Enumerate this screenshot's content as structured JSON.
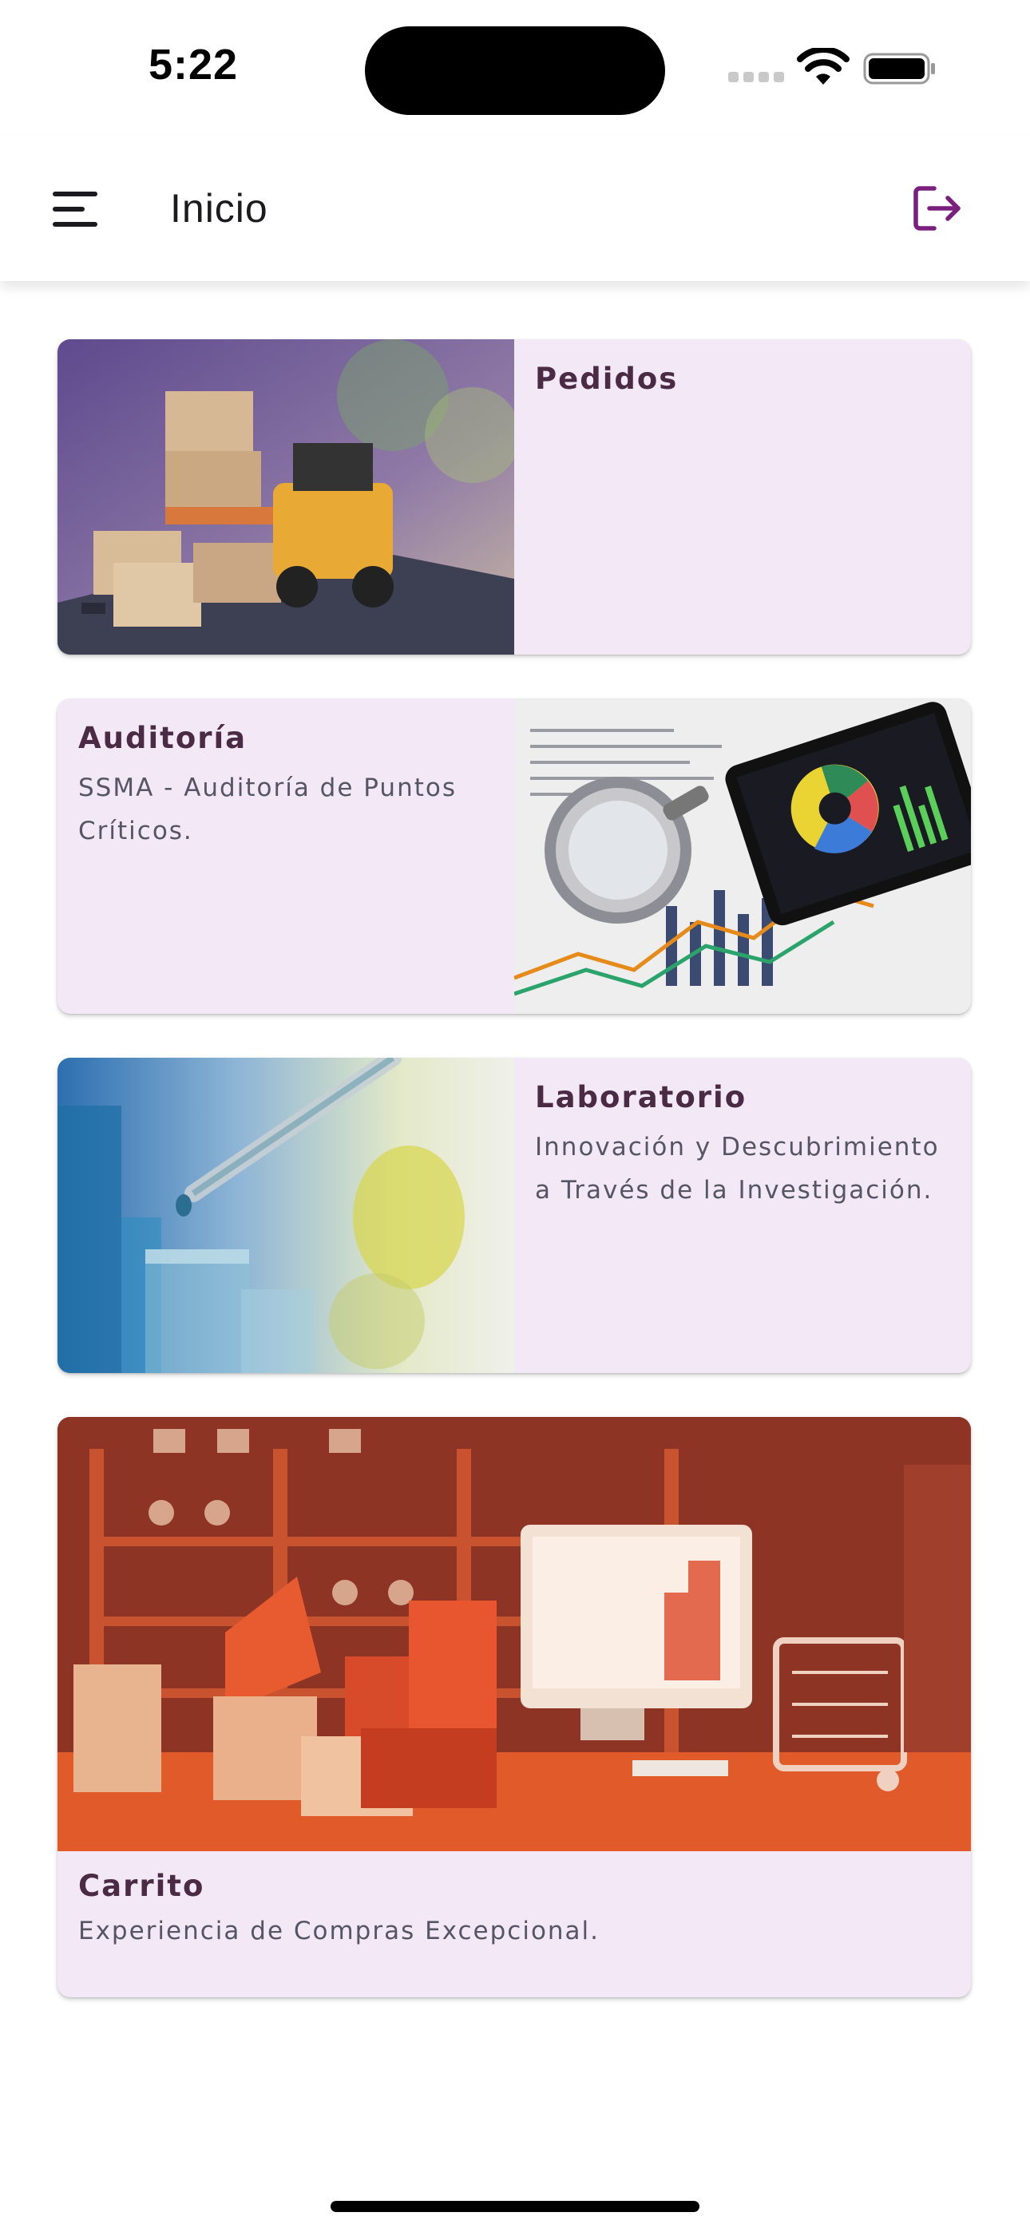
{
  "status_bar": {
    "time": "5:22"
  },
  "header": {
    "title": "Inicio"
  },
  "colors": {
    "accent": "#7b1f7e",
    "card_bg": "#f3e9f6",
    "title_text": "#4a2a44",
    "desc_text": "#555566"
  },
  "cards": [
    {
      "title": "Pedidos",
      "description": "",
      "image": "packages-forklift-laptop"
    },
    {
      "title": "Auditoría",
      "description": "SSMA - Auditoría de Puntos Críticos.",
      "image": "magnifier-tablet-charts"
    },
    {
      "title": "Laboratorio",
      "description": "Innovación y Descubrimiento a Través de la Investigación.",
      "image": "pipette-test-tubes"
    },
    {
      "title": "Carrito",
      "description": "Experiencia de Compras Excepcional.",
      "image": "boxes-monitor-cart"
    }
  ]
}
